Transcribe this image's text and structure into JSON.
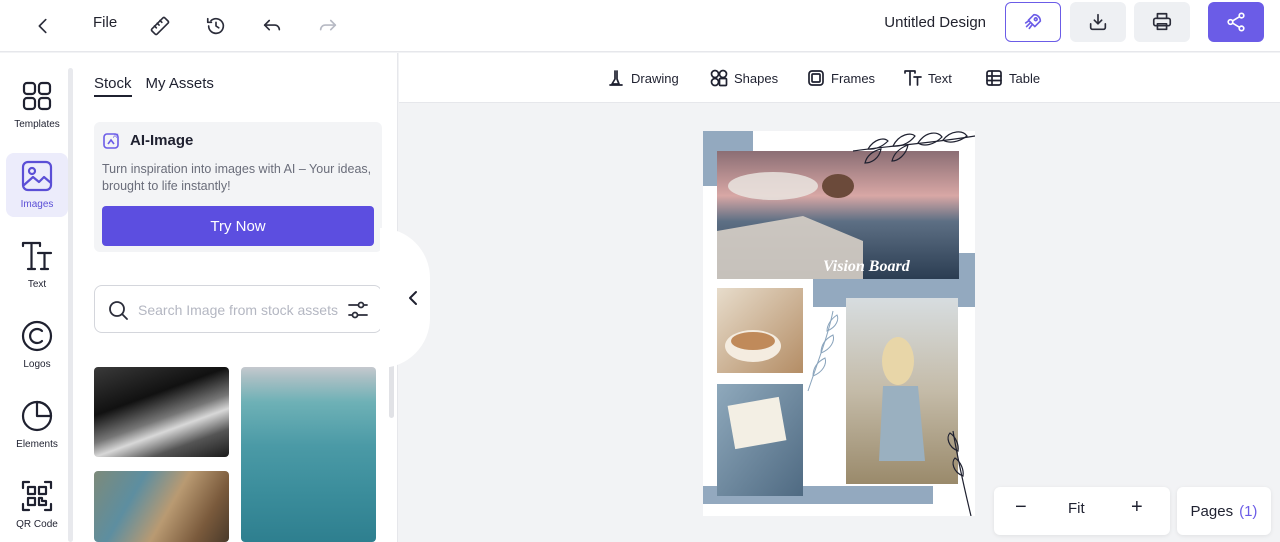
{
  "topbar": {
    "file_label": "File",
    "title": "Untitled Design",
    "icons": [
      "back-icon",
      "ruler-icon",
      "history-icon",
      "undo-icon",
      "redo-icon",
      "rocket-icon",
      "download-icon",
      "print-icon",
      "share-icon"
    ]
  },
  "rail": {
    "items": [
      {
        "label": "Templates",
        "icon": "templates-icon"
      },
      {
        "label": "Images",
        "icon": "images-icon"
      },
      {
        "label": "Text",
        "icon": "text-icon"
      },
      {
        "label": "Logos",
        "icon": "logos-icon"
      },
      {
        "label": "Elements",
        "icon": "elements-icon"
      },
      {
        "label": "QR Code",
        "icon": "qr-code-icon"
      }
    ],
    "active": "Images"
  },
  "panel": {
    "tabs": [
      {
        "label": "Stock"
      },
      {
        "label": "My Assets"
      }
    ],
    "ai_card": {
      "title": "AI-Image",
      "description": "Turn inspiration into images with AI – Your ideas, brought to life instantly!",
      "button": "Try Now"
    },
    "search": {
      "placeholder": "Search Image from stock assets"
    }
  },
  "toolstrip": {
    "tools": [
      {
        "label": "Drawing"
      },
      {
        "label": "Shapes"
      },
      {
        "label": "Frames"
      },
      {
        "label": "Text"
      },
      {
        "label": "Table"
      }
    ]
  },
  "canvas": {
    "headline": "Vision Board"
  },
  "zoom": {
    "minus": "−",
    "level": "Fit",
    "plus": "+"
  },
  "pages": {
    "label": "Pages",
    "count": "(1)"
  },
  "colors": {
    "accent": "#6b5ce7",
    "board_blue": "#93a9bf"
  }
}
